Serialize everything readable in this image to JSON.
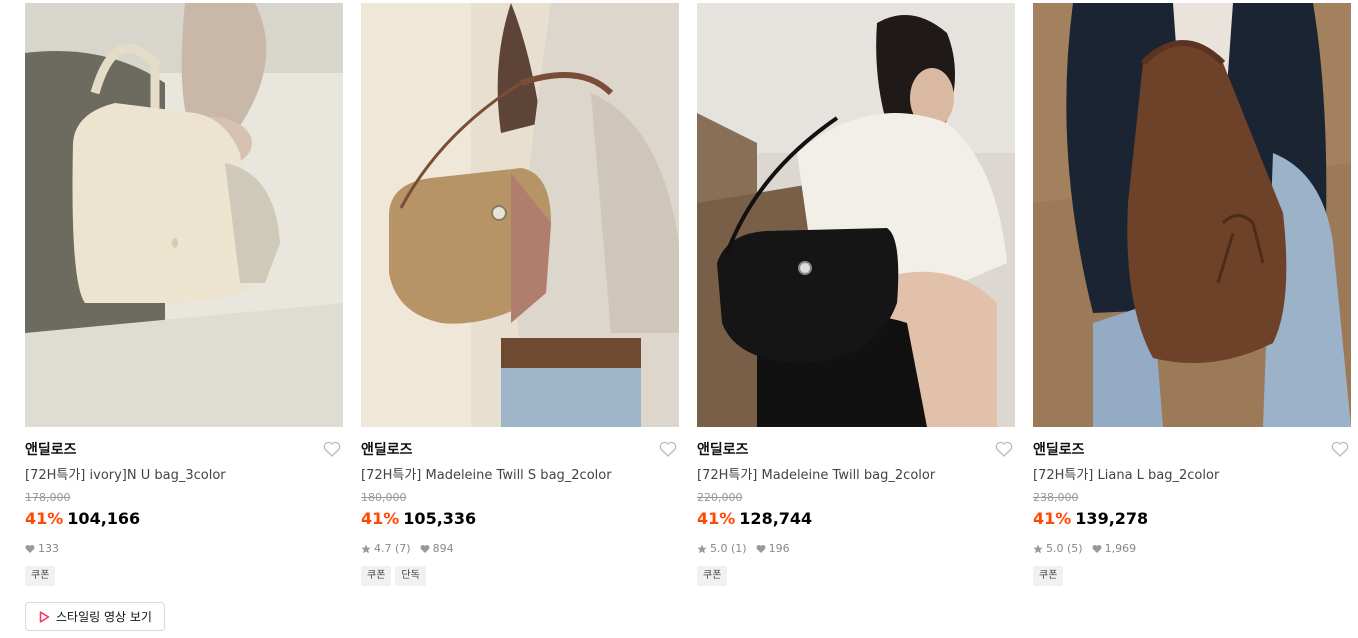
{
  "products": [
    {
      "brand": "앤딜로즈",
      "name": "[72H특가] ivory]N U bag_3color",
      "original_price": "178,000",
      "discount": "41%",
      "price": "104,166",
      "rating": "",
      "review_count": "",
      "likes": "133",
      "tags": [
        "쿠폰"
      ],
      "image": "ivory-u-bag-photo"
    },
    {
      "brand": "앤딜로즈",
      "name": "[72H특가] Madeleine Twill S bag_2color",
      "original_price": "180,000",
      "discount": "41%",
      "price": "105,336",
      "rating": "4.7",
      "review_count": "(7)",
      "likes": "894",
      "tags": [
        "쿠폰",
        "단독"
      ],
      "image": "beige-shoulder-bag-photo"
    },
    {
      "brand": "앤딜로즈",
      "name": "[72H특가] Madeleine Twill bag_2color",
      "original_price": "220,000",
      "discount": "41%",
      "price": "128,744",
      "rating": "5.0",
      "review_count": "(1)",
      "likes": "196",
      "tags": [
        "쿠폰"
      ],
      "image": "black-shoulder-bag-photo"
    },
    {
      "brand": "앤딜로즈",
      "name": "[72H특가] Liana L bag_2color",
      "original_price": "238,000",
      "discount": "41%",
      "price": "139,278",
      "rating": "5.0",
      "review_count": "(5)",
      "likes": "1,969",
      "tags": [
        "쿠폰"
      ],
      "image": "brown-suede-hobo-bag-photo"
    }
  ],
  "video_button": {
    "label": "스타일링 영상 보기",
    "icon": "play-icon"
  },
  "colors": {
    "discount": "#ff4800",
    "heart_outline": "#bbbbbb",
    "meta": "#888888",
    "tag_bg": "#f1f1f1",
    "play": "#ff3366"
  }
}
